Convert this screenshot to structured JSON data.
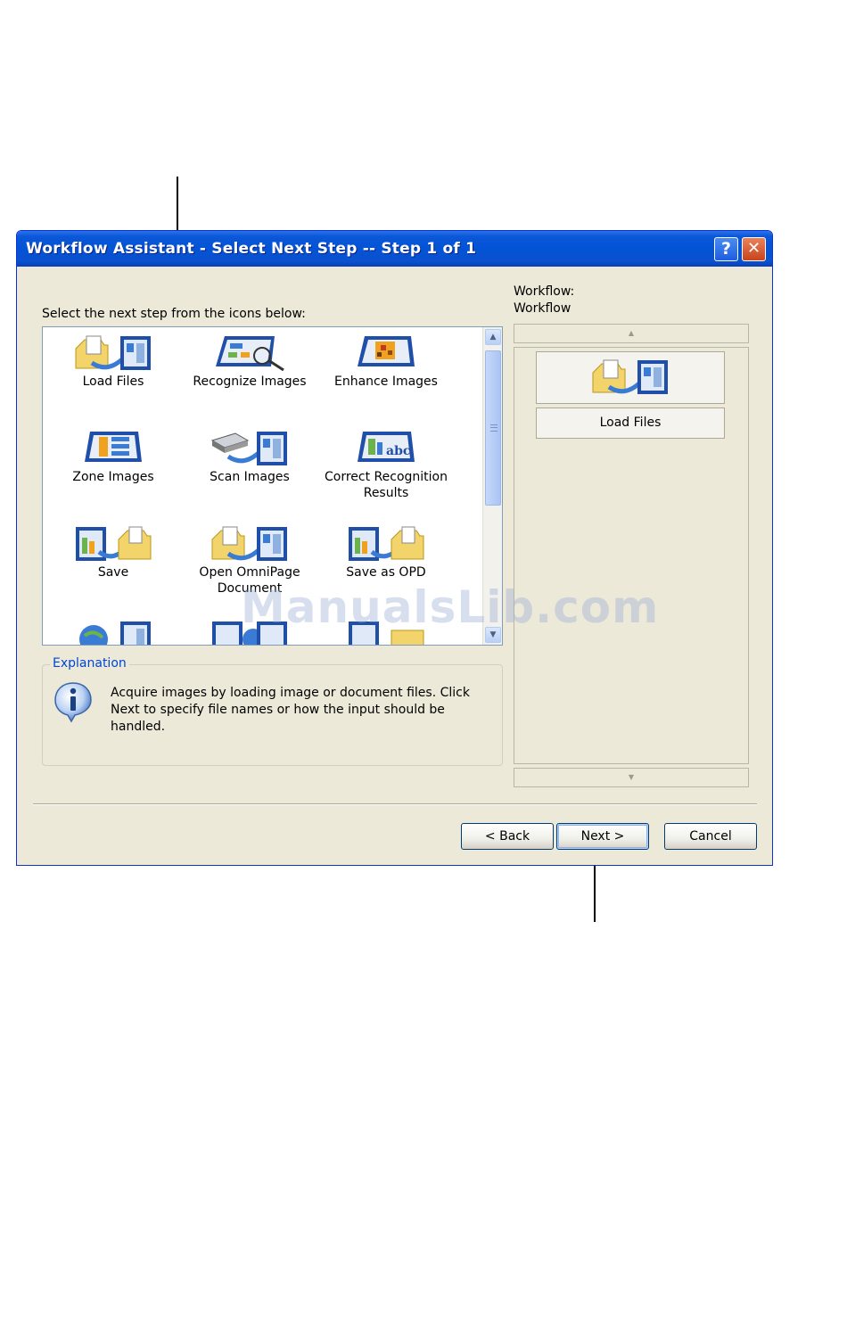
{
  "window": {
    "title": "Workflow Assistant - Select Next Step -- Step 1 of 1",
    "help_glyph": "?",
    "close_glyph": "✕"
  },
  "left": {
    "instruction": "Select the next step from the icons below:",
    "items": [
      {
        "label": "Load Files",
        "icon": "load-files-icon"
      },
      {
        "label": "Recognize Images",
        "icon": "recognize-images-icon"
      },
      {
        "label": "Enhance Images",
        "icon": "enhance-images-icon"
      },
      {
        "label": "Zone Images",
        "icon": "zone-images-icon"
      },
      {
        "label": "Scan Images",
        "icon": "scan-images-icon"
      },
      {
        "label": "Correct Recognition Results",
        "icon": "correct-recognition-icon"
      },
      {
        "label": "Save",
        "icon": "save-icon"
      },
      {
        "label": "Open OmniPage Document",
        "icon": "open-omnipage-icon"
      },
      {
        "label": "Save as OPD",
        "icon": "save-as-opd-icon"
      }
    ]
  },
  "explanation": {
    "legend": "Explanation",
    "text": "Acquire images by loading image or document files. Click Next to specify file names or how the input should be handled."
  },
  "workflow": {
    "label1": "Workflow:",
    "label2": "Workflow",
    "step_label": "Load Files"
  },
  "buttons": {
    "back": "< Back",
    "next": "Next >",
    "cancel": "Cancel"
  },
  "watermark": "ManualsLib.com",
  "colors": {
    "titlebar": "#0453d6",
    "dialog_bg": "#ece9d8",
    "group_legend": "#0046d5"
  }
}
